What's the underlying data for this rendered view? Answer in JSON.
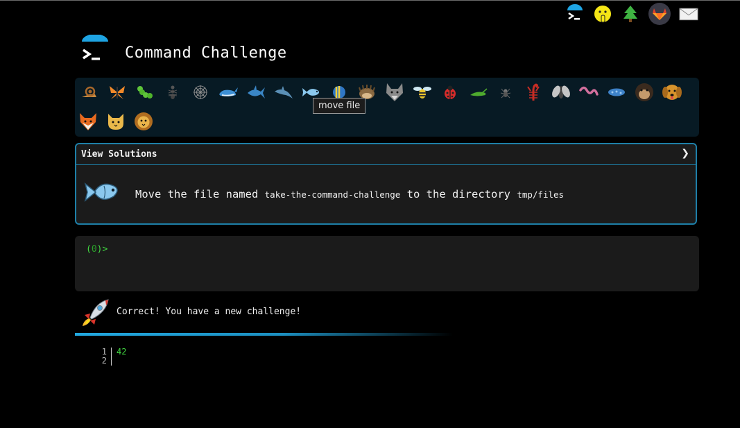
{
  "header": {
    "title": "Command Challenge",
    "logo_icon": "terminal-prompt-icon"
  },
  "top_nav": {
    "icons": [
      "terminal-icon",
      "shushing-face-icon",
      "tree-icon",
      "gitlab-icon",
      "mail-icon"
    ]
  },
  "challenges": {
    "icons": [
      "snail-icon",
      "butterfly-icon",
      "caterpillar-icon",
      "ant-icon",
      "spider-web-icon",
      "whale-icon",
      "shark-icon",
      "dolphin-icon",
      "fish-icon",
      "tropical-fish-icon",
      "hedgehog-icon",
      "wolf-icon",
      "bee-icon",
      "ladybug-icon",
      "cricket-icon",
      "spider-icon",
      "scorpion-icon",
      "fly-icon",
      "worm-icon",
      "microbe-icon",
      "gorilla-icon",
      "dog-icon",
      "fox-icon",
      "cat-icon",
      "lion-icon"
    ],
    "active_index": 8,
    "tooltip": "move file"
  },
  "solutions": {
    "label": "View Solutions",
    "chevron": "❯",
    "description_parts": {
      "p1": "Move the file named",
      "file": "take-the-command-challenge",
      "p2": "to the directory",
      "dir": "tmp/files"
    }
  },
  "terminal": {
    "prompt_open": "(",
    "prompt_num": "0",
    "prompt_close": ")>"
  },
  "status": {
    "message": "Correct! You have a new challenge!"
  },
  "output": {
    "line_numbers": [
      "1",
      "2"
    ],
    "lines": [
      "42"
    ]
  },
  "colors": {
    "accent": "#1e7fa8",
    "prompt": "#41d641",
    "bar_bg": "#071a24",
    "card_bg": "#1b1b1b"
  }
}
